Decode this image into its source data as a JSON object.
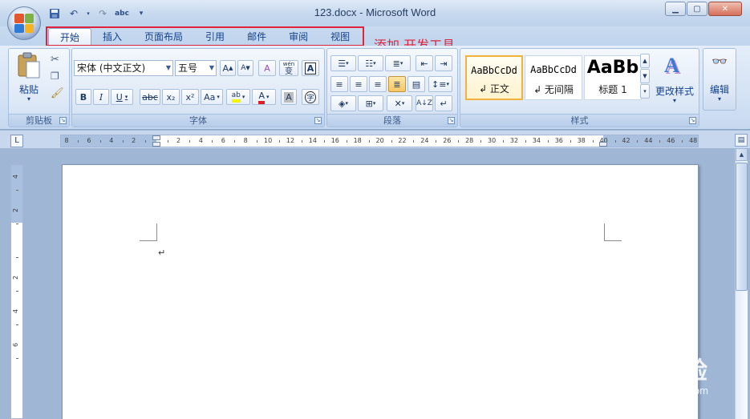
{
  "window": {
    "title": "123.docx - Microsoft Word",
    "controls": {
      "minimize": "▁",
      "maximize": "▢",
      "close": "✕"
    }
  },
  "quick_access": {
    "save_icon": "save-icon",
    "undo_icon": "undo-icon",
    "redo_icon": "redo-icon",
    "spell_icon": "abc",
    "customize_icon": "▾"
  },
  "tabs": [
    {
      "label": "开始",
      "active": true
    },
    {
      "label": "插入"
    },
    {
      "label": "页面布局"
    },
    {
      "label": "引用"
    },
    {
      "label": "邮件"
    },
    {
      "label": "审阅"
    },
    {
      "label": "视图"
    }
  ],
  "annotation": "添加  开发工具",
  "ribbon": {
    "clipboard": {
      "label": "剪贴板",
      "paste": "粘贴"
    },
    "font": {
      "label": "字体",
      "font_name": "宋体 (中文正文)",
      "font_size": "五号",
      "grow": "A",
      "shrink": "A",
      "clear": "A",
      "phonetic": "wén",
      "phonetic_char": "变",
      "border_char": "A",
      "bold": "B",
      "italic": "I",
      "underline": "U",
      "strike": "abc",
      "subscript": "x₂",
      "superscript": "x²",
      "case": "Aa",
      "highlight": "ab",
      "color": "A",
      "shading": "A",
      "enclose": "字"
    },
    "paragraph": {
      "label": "段落"
    },
    "styles": {
      "label": "样式",
      "items": [
        {
          "sample": "AaBbCcDd",
          "name": "↲ 正文",
          "selected": true
        },
        {
          "sample": "AaBbCcDd",
          "name": "↲ 无间隔"
        },
        {
          "sample": "AaBb",
          "name": "标题 1",
          "big": true
        }
      ],
      "change": "更改样式"
    },
    "editing": {
      "label": "编辑"
    }
  },
  "ruler": {
    "horizontal_ticks": [
      "8",
      "6",
      "4",
      "2",
      "",
      "2",
      "4",
      "6",
      "8",
      "10",
      "12",
      "14",
      "16",
      "18",
      "20",
      "22",
      "24",
      "26",
      "28",
      "30",
      "32",
      "34",
      "36",
      "38",
      "40",
      "42",
      "44",
      "46",
      "48"
    ],
    "vertical_ticks": [
      "4",
      "2",
      "",
      "2",
      "4",
      "6"
    ]
  },
  "document": {
    "paragraph_mark": "↵"
  },
  "watermark": {
    "main": "Bai 经验",
    "sub": "jingyan.baidu.com"
  }
}
